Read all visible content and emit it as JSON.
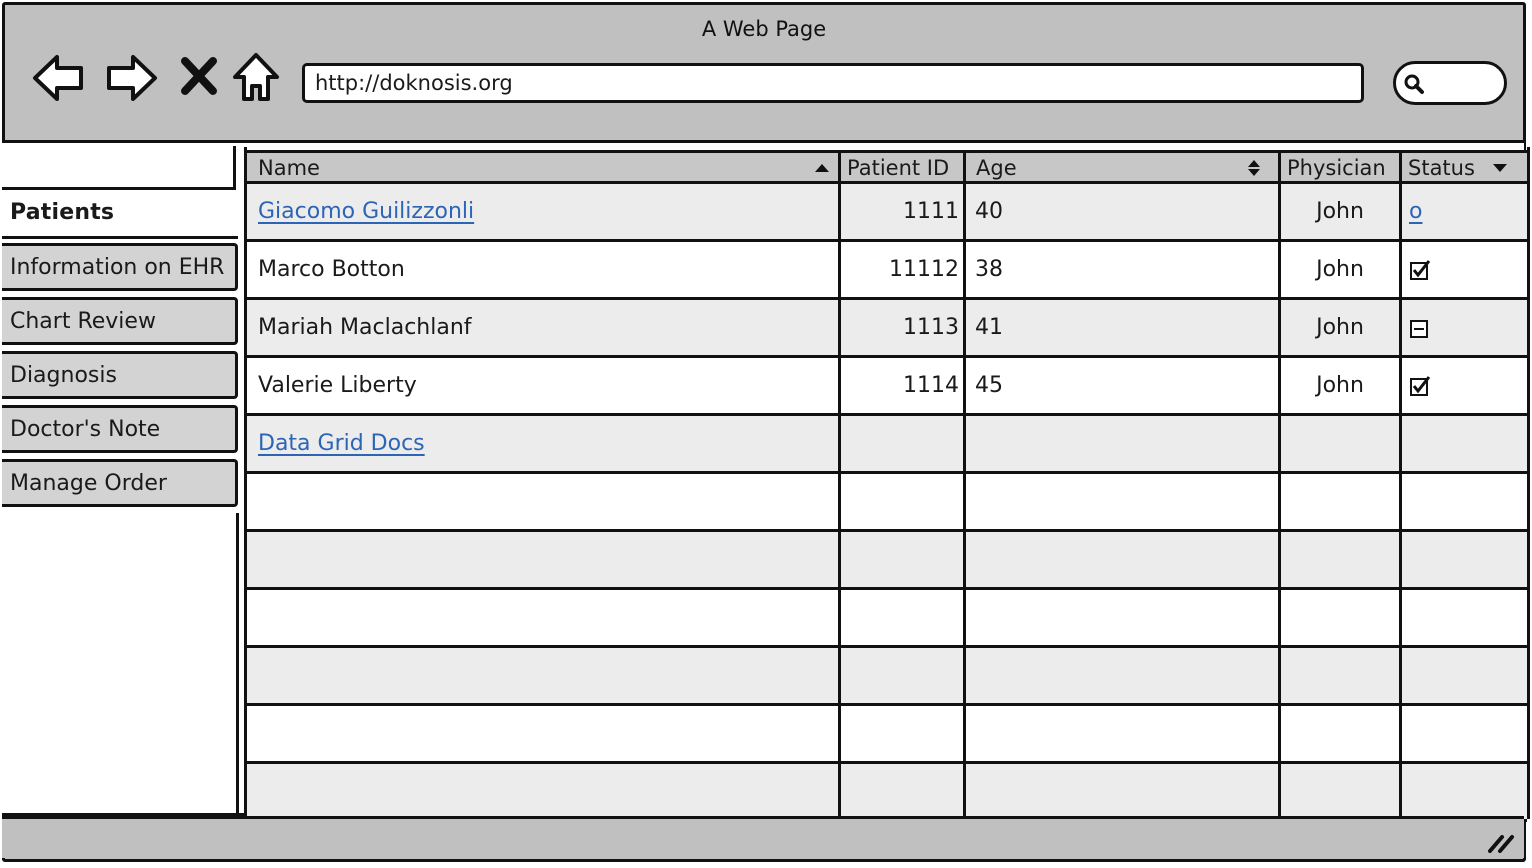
{
  "window": {
    "title": "A Web Page"
  },
  "browser": {
    "url": "http://doknosis.org",
    "back_icon": "back-arrow-icon",
    "forward_icon": "forward-arrow-icon",
    "stop_icon": "close-icon",
    "home_icon": "home-icon",
    "search_icon": "search-icon"
  },
  "sidebar": {
    "filter_value": "",
    "tabs": [
      {
        "label": "Patients",
        "selected": true
      },
      {
        "label": "Information on EHR",
        "selected": false
      },
      {
        "label": "Chart Review",
        "selected": false
      },
      {
        "label": "Diagnosis",
        "selected": false
      },
      {
        "label": "Doctor's Note",
        "selected": false
      },
      {
        "label": "Manage Order",
        "selected": false
      }
    ]
  },
  "grid": {
    "columns": [
      {
        "label": "Name",
        "sort": "ascending"
      },
      {
        "label": "Patient ID",
        "sort": "none"
      },
      {
        "label": "Age",
        "sort": "sortable"
      },
      {
        "label": "Physician",
        "sort": "none"
      },
      {
        "label": "Status",
        "sort": "dropdown"
      }
    ],
    "rows": [
      {
        "name": "Giacomo Guilizzonli",
        "name_is_link": true,
        "patient_id": "1111",
        "age": "40",
        "physician": "John",
        "status": "o",
        "status_type": "link"
      },
      {
        "name": "Marco Botton",
        "name_is_link": false,
        "patient_id": "11112",
        "age": "38",
        "physician": "John",
        "status": "checked",
        "status_type": "checkbox-checked"
      },
      {
        "name": "Mariah Maclachlanf",
        "name_is_link": false,
        "patient_id": "1113",
        "age": "41",
        "physician": "John",
        "status": "indeterminate",
        "status_type": "checkbox-indeterminate"
      },
      {
        "name": "Valerie Liberty",
        "name_is_link": false,
        "patient_id": "1114",
        "age": "45",
        "physician": "John",
        "status": "checked",
        "status_type": "checkbox-checked"
      },
      {
        "name": "Data Grid Docs",
        "name_is_link": true,
        "patient_id": "",
        "age": "",
        "physician": "",
        "status": "",
        "status_type": "none"
      }
    ],
    "empty_row_count": 6
  },
  "colors": {
    "chrome": "#c0c0c0",
    "header": "#c7c7c7",
    "row_alt": "#ececec",
    "link": "#2c65b5",
    "border": "#111111"
  }
}
